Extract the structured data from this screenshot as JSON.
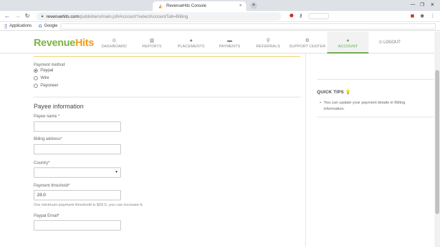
{
  "browser": {
    "tab_title": "RevenueHits Console",
    "tab_close": "×",
    "new_tab": "+",
    "window_controls": [
      "—",
      "❐",
      "✕"
    ],
    "url_host": "revenuehits.com",
    "url_path": "/publishers/main.jsf#Account?selectAccountTab=Billing",
    "back": "←",
    "forward": "→",
    "reload": "↻"
  },
  "bookmarks": {
    "apps_label": "Applications",
    "google_label": "Google"
  },
  "header": {
    "logo_part1": "Revenue",
    "logo_part2": "Hits",
    "nav": [
      {
        "label": "DASHBOARD",
        "icon": "⊙"
      },
      {
        "label": "REPORTS",
        "icon": "▥"
      },
      {
        "label": "PLACEMENTS",
        "icon": "●"
      },
      {
        "label": "PAYMENTS",
        "icon": "▬"
      },
      {
        "label": "REFERRALS",
        "icon": "⚲"
      },
      {
        "label": "SUPPORT CENTER",
        "icon": "⚙"
      },
      {
        "label": "ACCOUNT",
        "icon": "●"
      }
    ],
    "logout": "⏻ LOGOUT"
  },
  "form": {
    "payment_method_label": "Payment method",
    "methods": [
      "Paypal",
      "Wire",
      "Payoneer"
    ],
    "selected_method": "Paypal",
    "payee_title": "Payee information",
    "payee_name_label": "Payee name *",
    "payee_name_value": "",
    "billing_address_label": "Billing address*",
    "billing_address_value": "",
    "country_label": "Country*",
    "country_value": "",
    "threshold_label": "Payment threshold*",
    "threshold_value": "20.0",
    "threshold_help": "Our minimum payment threshold is $20.0, you can increase it.",
    "paypal_email_label": "Paypal Email*",
    "paypal_email_value": ""
  },
  "quick_tips": {
    "title": "QUICK TIPS 💡",
    "items": [
      "You can update your payment details in Billing information."
    ]
  },
  "colors": {
    "brand_green": "#7cb342",
    "brand_orange": "#f39c12",
    "active_nav": "#6aa84f"
  }
}
